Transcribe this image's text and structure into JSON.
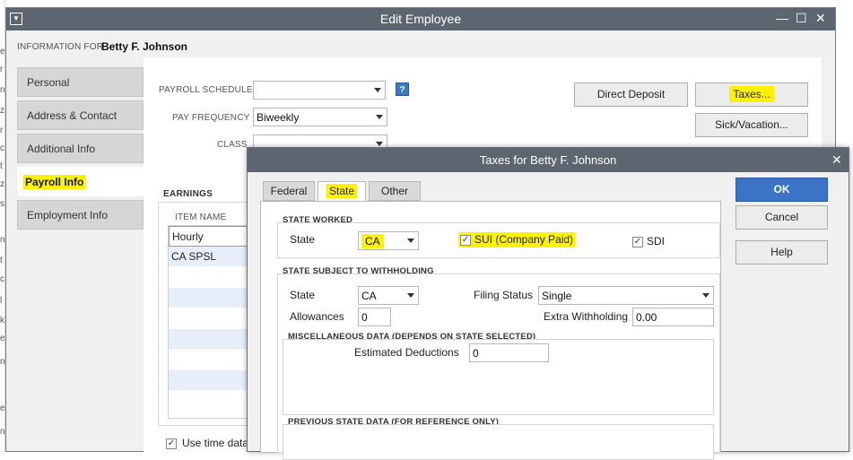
{
  "edit_employee": {
    "title": "Edit Employee",
    "info_for_label": "INFORMATION FOR",
    "employee_name": "Betty F. Johnson",
    "tabs": [
      {
        "label": "Personal"
      },
      {
        "label": "Address & Contact"
      },
      {
        "label": "Additional Info"
      },
      {
        "label": "Payroll Info"
      },
      {
        "label": "Employment Info"
      }
    ],
    "payroll_schedule_label": "PAYROLL SCHEDULE",
    "payroll_schedule_value": "",
    "pay_frequency_label": "PAY FREQUENCY",
    "pay_frequency_value": "Biweekly",
    "class_label": "CLASS",
    "class_value": "",
    "help_glyph": "?",
    "direct_deposit": "Direct Deposit",
    "taxes": "Taxes...",
    "sick_vacation": "Sick/Vacation...",
    "earnings_header": "EARNINGS",
    "item_name_header": "ITEM NAME",
    "earnings_rows": [
      "Hourly",
      "CA SPSL",
      "",
      "",
      "",
      "",
      "",
      "",
      ""
    ],
    "use_time_data": "Use time data"
  },
  "taxes_dialog": {
    "title": "Taxes for Betty F. Johnson",
    "tabs": [
      {
        "label": "Federal"
      },
      {
        "label": "State"
      },
      {
        "label": "Other"
      }
    ],
    "state_worked_header": "STATE WORKED",
    "state_label": "State",
    "state_worked_value": "CA",
    "sui_label": "SUI (Company Paid)",
    "sui_checked": true,
    "sdi_label": "SDI",
    "sdi_checked": true,
    "withholding_header": "STATE SUBJECT TO WITHHOLDING",
    "withholding_state_label": "State",
    "withholding_state_value": "CA",
    "filing_status_label": "Filing Status",
    "filing_status_value": "Single",
    "allowances_label": "Allowances",
    "allowances_value": "0",
    "extra_withholding_label": "Extra Withholding",
    "extra_withholding_value": "0.00",
    "misc_header": "MISCELLANEOUS DATA (DEPENDS ON STATE SELECTED)",
    "estimated_deductions_label": "Estimated Deductions",
    "estimated_deductions_value": "0",
    "previous_header": "PREVIOUS STATE DATA (FOR REFERENCE ONLY)",
    "ok": "OK",
    "cancel": "Cancel",
    "help": "Help",
    "close_glyph": "✕",
    "check_glyph": "✓"
  },
  "window_controls": {
    "minimize": "—",
    "maximize": "☐",
    "close": "✕"
  },
  "background_letters": [
    "e",
    "r",
    "n",
    "z",
    "r",
    "c",
    "t",
    "z",
    "s",
    "n",
    "t",
    "c",
    "l",
    "k",
    "e",
    "n",
    "e",
    "n"
  ],
  "colors": {
    "titlebar": "#5d6670",
    "highlight": "#fff200",
    "ok_button": "#3b73c6",
    "grid_alt_row": "#e7eefa"
  }
}
